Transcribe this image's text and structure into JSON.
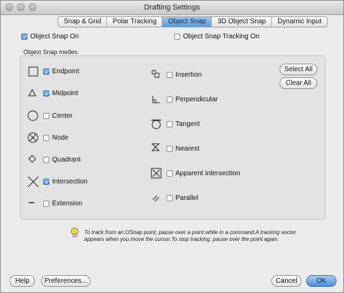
{
  "window": {
    "title": "Drafting Settings"
  },
  "tabs": [
    {
      "label": "Snap & Grid",
      "active": false
    },
    {
      "label": "Polar Tracking",
      "active": false
    },
    {
      "label": "Object Snap",
      "active": true
    },
    {
      "label": "3D Object Snap",
      "active": false
    },
    {
      "label": "Dynamic Input",
      "active": false
    }
  ],
  "options": {
    "osnap_on": {
      "label": "Object Snap On",
      "checked": true
    },
    "tracking_on": {
      "label": "Object Snap Tracking On",
      "checked": false
    }
  },
  "modes_group": {
    "title": "Object Snap modes"
  },
  "left_modes": [
    {
      "label": "Endpoint",
      "checked": true,
      "icon": "endpoint-icon"
    },
    {
      "label": "Midpoint",
      "checked": true,
      "icon": "midpoint-icon"
    },
    {
      "label": "Center",
      "checked": false,
      "icon": "center-icon"
    },
    {
      "label": "Node",
      "checked": false,
      "icon": "node-icon"
    },
    {
      "label": "Quadrant",
      "checked": false,
      "icon": "quadrant-icon"
    },
    {
      "label": "Intersection",
      "checked": true,
      "icon": "intersection-icon"
    },
    {
      "label": "Extension",
      "checked": false,
      "icon": "extension-icon"
    }
  ],
  "right_modes": [
    {
      "label": "Insertion",
      "checked": false,
      "icon": "insertion-icon"
    },
    {
      "label": "Perpendicular",
      "checked": false,
      "icon": "perpendicular-icon"
    },
    {
      "label": "Tangent",
      "checked": false,
      "icon": "tangent-icon"
    },
    {
      "label": "Nearest",
      "checked": false,
      "icon": "nearest-icon"
    },
    {
      "label": "Apparent intersection",
      "checked": false,
      "icon": "apparent-intersection-icon"
    },
    {
      "label": "Parallel",
      "checked": false,
      "icon": "parallel-icon"
    }
  ],
  "buttons": {
    "select_all": "Select All",
    "clear_all": "Clear All",
    "help": "Help",
    "preferences": "Preferences...",
    "cancel": "Cancel",
    "ok": "OK"
  },
  "tip": {
    "text": "To track from an OSnap point, pause over a point while in a command.A tracking vector appears when you move the cursor.To stop tracking, pause over the point again."
  },
  "colors": {
    "accent": "#4c8fd8",
    "panel": "#e3e3e3"
  }
}
